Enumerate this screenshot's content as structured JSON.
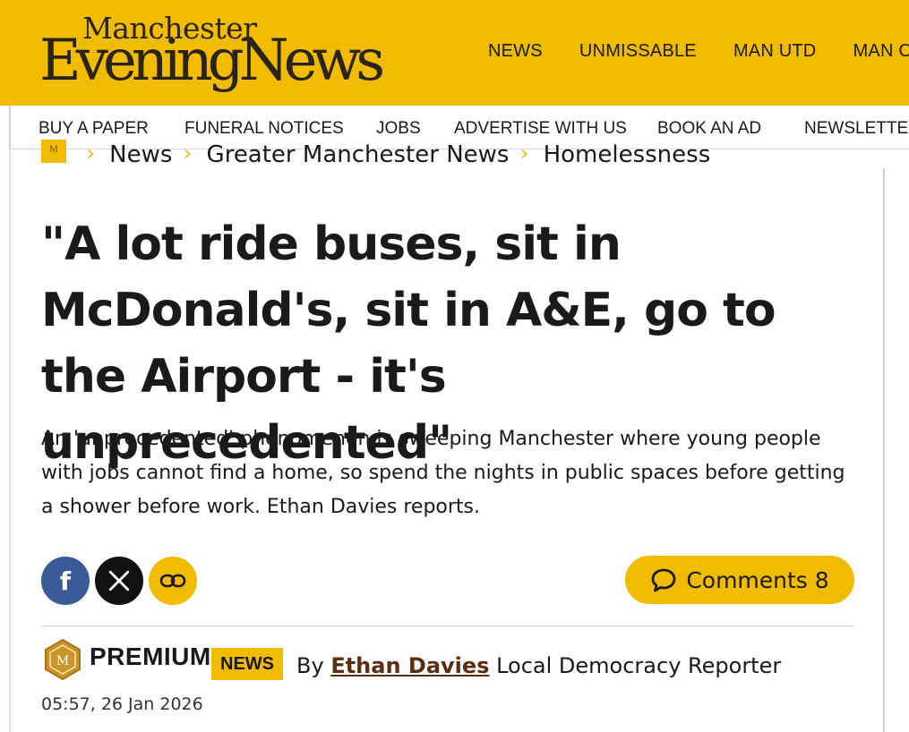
{
  "header": {
    "logo_top": "Manchester",
    "logo_bottom": "EveningNews",
    "nav": [
      "NEWS",
      "UNMISSABLE",
      "MAN UTD",
      "MAN CITY"
    ]
  },
  "subnav": [
    "BUY A PAPER",
    "FUNERAL NOTICES",
    "JOBS",
    "ADVERTISE WITH US",
    "BOOK AN AD",
    "NEWSLETTERS"
  ],
  "breadcrumb": {
    "home_icon": "men-logo-icon",
    "items": [
      "News",
      "Greater Manchester News",
      "Homelessness"
    ]
  },
  "article": {
    "headline": "\"A lot ride buses, sit in McDonald's, sit in A&E, go to the Airport - it's unprecedented\"",
    "standfirst": "An 'unprecedented' phenomenon is sweeping Manchester where young people with jobs cannot find a home, so spend the nights in public spaces before getting a shower before work. Ethan Davies reports.",
    "share": {
      "facebook_icon": "f"
    },
    "comments_label": "Comments",
    "comments_count": "8",
    "premium_label": "PREMIUM",
    "category_tag": "NEWS",
    "byline_prefix": "By",
    "author": "Ethan Davies",
    "author_role": "Local Democracy Reporter",
    "timestamp": "05:57, 26 Jan 2026"
  },
  "colors": {
    "brand_yellow": "#f1bc00",
    "facebook": "#3b5a98",
    "author_link": "#5a2e12"
  }
}
